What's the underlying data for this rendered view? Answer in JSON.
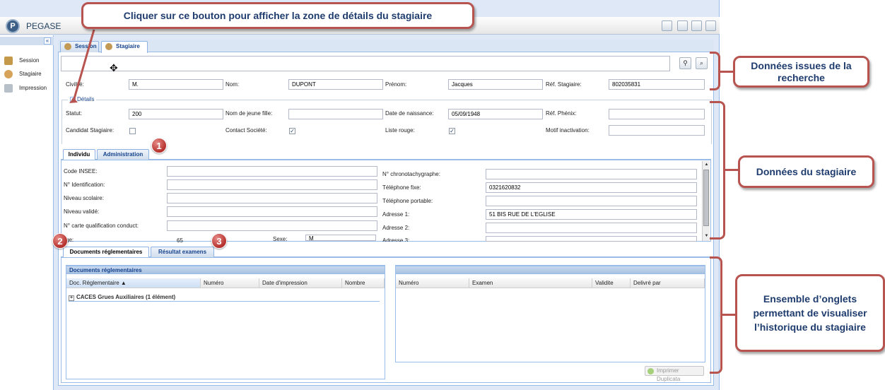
{
  "app": {
    "title": "PEGASE"
  },
  "sidebar": {
    "items": [
      {
        "label": "Session",
        "icon": "session-icon"
      },
      {
        "label": "Stagiaire",
        "icon": "person-icon"
      },
      {
        "label": "Impression",
        "icon": "printer-icon"
      }
    ]
  },
  "tabs": [
    {
      "label": "Session"
    },
    {
      "label": "Stagiaire"
    }
  ],
  "form": {
    "civilite_label": "Civilité:",
    "civilite_value": "M.",
    "nom_label": "Nom:",
    "nom_value": "DUPONT",
    "prenom_label": "Prénom:",
    "prenom_value": "Jacques",
    "ref_label": "Réf. Stagiaire:",
    "ref_value": "802035831",
    "details_legend": "Détails",
    "statut_label": "Statut:",
    "statut_value": "200",
    "nom_jf_label": "Nom de jeune fille:",
    "nom_jf_value": "",
    "naissance_label": "Date de naissance:",
    "naissance_value": "05/09/1948",
    "ref_phenix_label": "Réf. Phénix:",
    "ref_phenix_value": "",
    "candidat_label": "Candidat Stagiaire:",
    "candidat_checked": false,
    "contact_label": "Contact Société:",
    "contact_checked": true,
    "liste_rouge_label": "Liste rouge:",
    "liste_rouge_checked": true,
    "motif_label": "Motif inactivation:",
    "motif_value": ""
  },
  "subtabs": [
    {
      "label": "Individu"
    },
    {
      "label": "Administration"
    }
  ],
  "individu": {
    "left": [
      {
        "label": "Code INSEE:",
        "value": ""
      },
      {
        "label": "N° Identification:",
        "value": ""
      },
      {
        "label": "Niveau scolaire:",
        "value": ""
      },
      {
        "label": "Niveau validé:",
        "value": ""
      },
      {
        "label": "N° carte qualification conduct:",
        "value": ""
      }
    ],
    "right": [
      {
        "label": "N° chronotachygraphe:",
        "value": ""
      },
      {
        "label": "Téléphone fixe:",
        "value": "0321620832"
      },
      {
        "label": "Téléphone portable:",
        "value": ""
      },
      {
        "label": "Adresse 1:",
        "value": "51 BIS RUE DE L'EGLISE"
      },
      {
        "label": "Adresse 2:",
        "value": ""
      },
      {
        "label": "Adresse 3:",
        "value": ""
      }
    ],
    "partial_label": "ge:",
    "partial_value": "65",
    "sexe_label": "Sexe:",
    "sexe_value": "M"
  },
  "bottom_tabs": [
    {
      "label": "Documents réglementaires"
    },
    {
      "label": "Résultat examens"
    }
  ],
  "documents": {
    "title": "Documents réglementaires",
    "columns": [
      "Doc. Réglementaire ▲",
      "Numéro",
      "Date d'impression",
      "Nombre"
    ],
    "group": "CACES Grues Auxiliaires (1 élément)"
  },
  "examens": {
    "columns": [
      "Numéro",
      "Examen",
      "Validite",
      "Delivré par"
    ]
  },
  "print_button": "Imprimer Duplicata",
  "annotations": {
    "top": "Cliquer sur ce bouton pour afficher la zone de détails du stagiaire",
    "search": "Données issues de la recherche",
    "stagiaire": "Données du stagiaire",
    "history": "Ensemble d’onglets permettant de visualiser l’historique du stagiaire",
    "badges": [
      "1",
      "2",
      "3"
    ]
  },
  "colors": {
    "accent": "#b85450",
    "callout_text": "#1f3c6e",
    "ext_blue": "#99bbe8"
  }
}
